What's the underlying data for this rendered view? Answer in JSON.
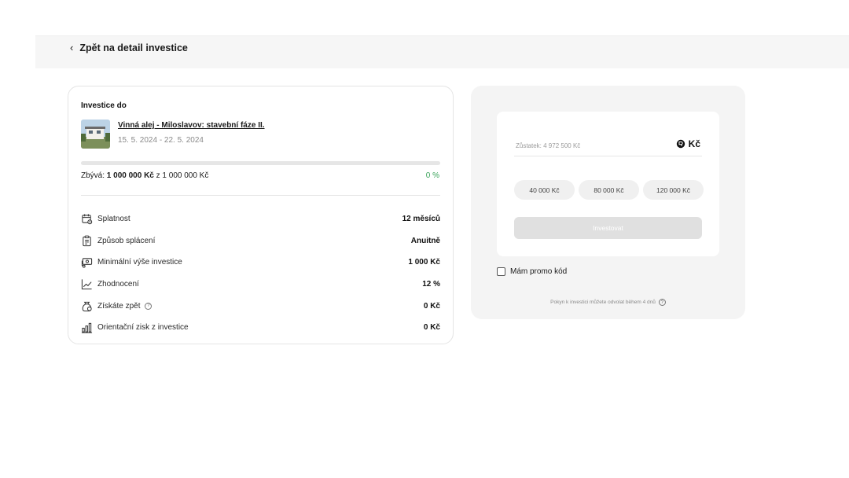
{
  "nav": {
    "back_label": "Zpět na detail investice"
  },
  "investment": {
    "heading": "Investice do",
    "project_title": "Vinná alej - Miloslavov: stavební fáze II.",
    "dates": "15. 5. 2024 - 22. 5. 2024",
    "remaining_prefix": "Zbývá:",
    "remaining_amount": "1 000 000 Kč",
    "remaining_total": "z 1 000 000 Kč",
    "progress_percent": 0,
    "progress_label": "0 %",
    "details": [
      {
        "icon": "calendar-icon",
        "label": "Splatnost",
        "value": "12 měsíců"
      },
      {
        "icon": "clipboard-icon",
        "label": "Způsob splácení",
        "value": "Anuitně"
      },
      {
        "icon": "money-icon",
        "label": "Minimální výše investice",
        "value": "1 000 Kč"
      },
      {
        "icon": "trend-icon",
        "label": "Zhodnocení",
        "value": "12 %"
      },
      {
        "icon": "moneybag-icon",
        "label": "Získáte zpět",
        "value": "0 Kč"
      },
      {
        "icon": "bars-icon",
        "label": "Orientační zisk z investice",
        "value": "0 Kč"
      }
    ]
  },
  "order": {
    "balance_label": "Zůstatek: 4 972 500 Kč",
    "currency": "Kč",
    "chips": [
      "40 000 Kč",
      "80 000 Kč",
      "120 000 Kč"
    ],
    "invest_button": "Investovat",
    "promo_label": "Mám promo kód",
    "note": "Pokyn k investici můžete odvolat během 4 dnů"
  },
  "colors": {
    "accent_green": "#3aa35a",
    "panel_bg": "#f4f4f4"
  }
}
